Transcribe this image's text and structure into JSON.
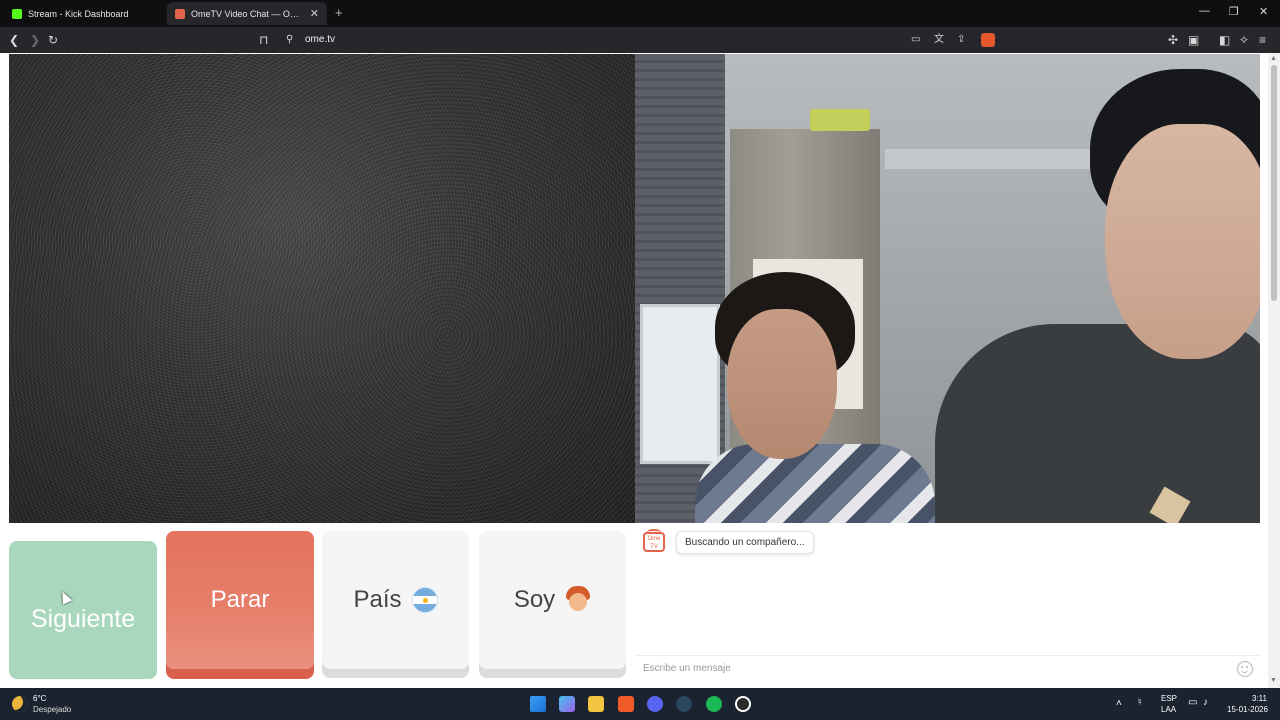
{
  "browser": {
    "tabs": [
      {
        "label": "Stream - Kick Dashboard",
        "favicon_color": "#53fc18"
      },
      {
        "label": "OmeTV Video Chat — Omegle",
        "favicon_color": "#e4634b"
      }
    ],
    "new_tab": "+",
    "url": "ome.tv",
    "window_controls": {
      "minimize": "—",
      "restore": "❐",
      "close": "✕"
    }
  },
  "controls": {
    "next_label": "Siguiente",
    "stop_label": "Parar",
    "country_label": "País",
    "gender_label": "Soy"
  },
  "chat": {
    "logo_text": "Ome TV",
    "status_message": "Buscando un compañero...",
    "input_placeholder": "Escribe un mensaje"
  },
  "taskbar": {
    "weather_temp": "6°C",
    "weather_desc": "Despejado",
    "language": "ESP",
    "language_sub": "LAA",
    "time": "3:11",
    "date": "15-01-2026"
  },
  "colors": {
    "next_button": "#a9d7bd",
    "stop_button": "#e4735c",
    "accent": "#e4634b"
  }
}
